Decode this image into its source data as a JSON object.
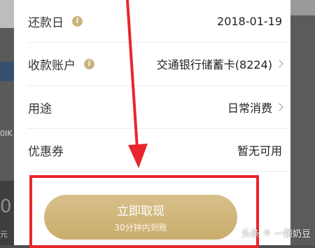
{
  "background": {
    "left_fragments": [
      "0IK",
      "0",
      "元"
    ]
  },
  "rows": [
    {
      "label": "还款日",
      "has_info": true,
      "value": "2018-01-19",
      "has_chevron": false
    },
    {
      "label": "收款账户",
      "has_info": true,
      "value": "交通银行储蓄卡(8224)",
      "has_chevron": true
    },
    {
      "label": "用途",
      "has_info": false,
      "value": "日常消费",
      "has_chevron": true
    },
    {
      "label": "优惠券",
      "has_info": false,
      "value": "暂无可用",
      "has_chevron": false
    }
  ],
  "action": {
    "title": "立即取现",
    "subtitle": "30分钟内到账"
  },
  "watermark": {
    "source": "头条",
    "author": "一颗奶豆"
  },
  "colors": {
    "gold": "#c9ad6d",
    "annotation_red": "#e8262c"
  }
}
